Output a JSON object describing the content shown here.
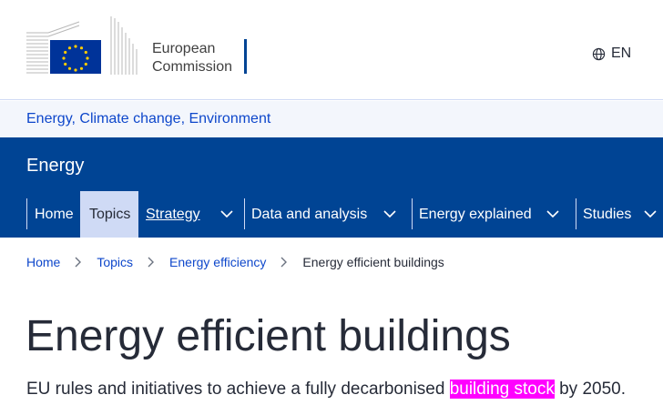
{
  "header": {
    "logo_line1": "European",
    "logo_line2": "Commission",
    "language": "EN",
    "language_icon": "globe-icon"
  },
  "siteband": {
    "label": "Energy, Climate change, Environment"
  },
  "site": {
    "name": "Energy"
  },
  "menu": {
    "items": [
      {
        "label": "Home"
      },
      {
        "label": "Topics"
      },
      {
        "label": "Strategy"
      },
      {
        "label": "Data and analysis"
      },
      {
        "label": "Energy explained"
      },
      {
        "label": "Studies"
      }
    ]
  },
  "breadcrumb": {
    "items": [
      "Home",
      "Topics",
      "Energy efficiency"
    ],
    "current": "Energy efficient buildings"
  },
  "page": {
    "title": "Energy efficient buildings",
    "subtitle_before": "EU rules and initiatives to achieve a fully decarbonised ",
    "subtitle_highlight": "building stock",
    "subtitle_after": " by 2050."
  },
  "colors": {
    "brand_blue": "#004494",
    "link_blue": "#0e47cb",
    "highlight": "#ff00ff",
    "active_tab": "#cfdaf5"
  }
}
